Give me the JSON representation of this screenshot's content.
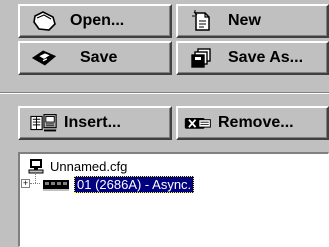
{
  "buttons": {
    "open": "Open...",
    "new": "New",
    "save": "Save",
    "save_as": "Save As...",
    "insert": "Insert...",
    "remove": "Remove..."
  },
  "tree": {
    "root": "Unnamed.cfg",
    "child": "01 (2686A) - Async."
  },
  "colors": {
    "face": "#c0c0c0",
    "selection": "#000080"
  }
}
